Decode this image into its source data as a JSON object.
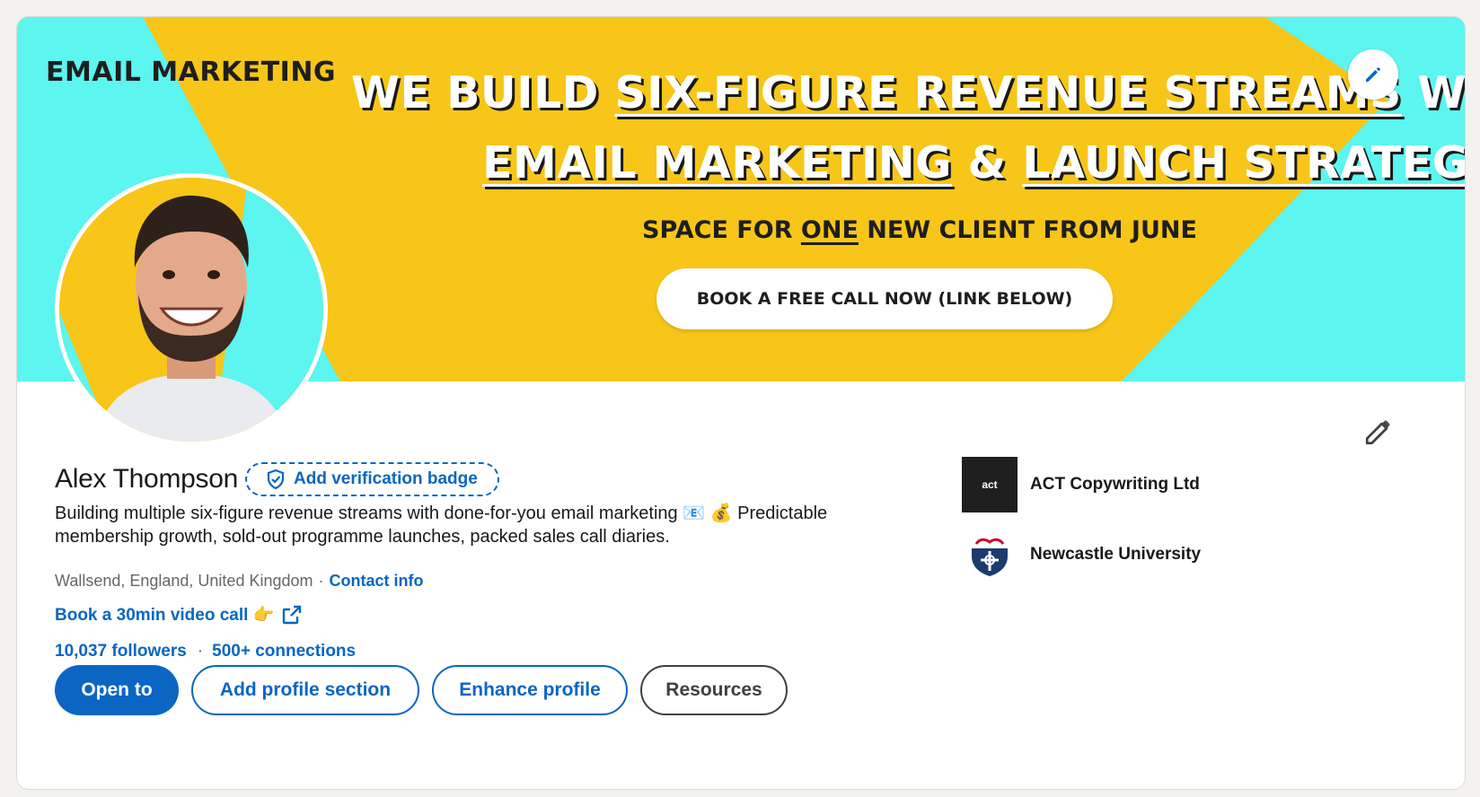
{
  "banner": {
    "tag": "EMAIL MARKETING",
    "headline_1_pre": "WE BUILD ",
    "headline_1_underlined": "SIX-FIGURE REVENUE STREAMS",
    "headline_1_post": " WITH",
    "headline_2_underlined_a": "EMAIL MARKETING",
    "headline_2_mid": " & ",
    "headline_2_underlined_b": "LAUNCH STRATEGY",
    "sub_pre": "SPACE FOR ",
    "sub_underlined": "ONE",
    "sub_post": " NEW CLIENT FROM JUNE",
    "cta": "BOOK A FREE CALL NOW (LINK BELOW)",
    "colors": {
      "yellow": "#f7c619",
      "cyan": "#5cf5f0"
    }
  },
  "profile": {
    "name": "Alex Thompson",
    "verification_badge": "Add verification badge",
    "headline": "Building multiple six-figure revenue streams with done-for-you email marketing 📧 💰 Predictable membership growth, sold-out programme launches, packed sales call diaries.",
    "location": "Wallsend, England, United Kingdom",
    "location_sep": "·",
    "contact_info": "Contact info",
    "book_link": "Book a 30min video call 👉",
    "followers": "10,037 followers",
    "followers_sep": "·",
    "connections": "500+ connections"
  },
  "actions": {
    "open_to": "Open to",
    "add_section": "Add profile section",
    "enhance": "Enhance profile",
    "resources": "Resources"
  },
  "orgs": [
    {
      "name": "ACT Copywriting Ltd",
      "logo_text": "act"
    },
    {
      "name": "Newcastle University"
    }
  ],
  "icons": {
    "banner_edit": "pencil-icon",
    "profile_edit": "pencil-icon",
    "verify": "shield-check-icon",
    "external": "external-link-icon"
  },
  "colors": {
    "brand_blue": "#0a66c2"
  }
}
